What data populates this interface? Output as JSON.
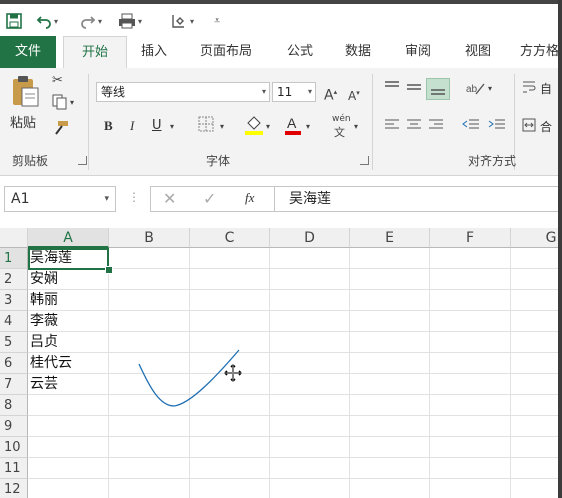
{
  "colors": {
    "accent": "#217346",
    "ribbon_bg": "#f3f3f3",
    "ink": "#1f6fb2"
  },
  "quick_access": {
    "save_icon": "save-icon",
    "undo_icon": "undo-icon",
    "redo_icon": "redo-icon",
    "print_icon": "print-preview-icon",
    "touch_icon": "touch-mode-icon",
    "customize_icon": "customize-icon"
  },
  "tabs": [
    "文件",
    "开始",
    "插入",
    "页面布局",
    "公式",
    "数据",
    "审阅",
    "视图",
    "方方格"
  ],
  "ribbon": {
    "clipboard": {
      "paste": "粘贴",
      "label": "剪贴板"
    },
    "font": {
      "name": "等线",
      "size": "11",
      "bold": "B",
      "italic": "I",
      "underline": "U",
      "phonetic": "wén",
      "label": "字体"
    },
    "alignment": {
      "wrap": "自",
      "merge": "合",
      "label": "对齐方式"
    }
  },
  "formula_bar": {
    "name_box": "A1",
    "fx": "fx",
    "content": "吴海莲"
  },
  "grid": {
    "columns": [
      "A",
      "B",
      "C",
      "D",
      "E",
      "F",
      "G"
    ],
    "rows": [
      "1",
      "2",
      "3",
      "4",
      "5",
      "6",
      "7",
      "8",
      "9",
      "10",
      "11",
      "12"
    ],
    "column_a": [
      "吴海莲",
      "安娴",
      "韩丽",
      "李薇",
      "吕贞",
      "桂代云",
      "云芸"
    ]
  }
}
